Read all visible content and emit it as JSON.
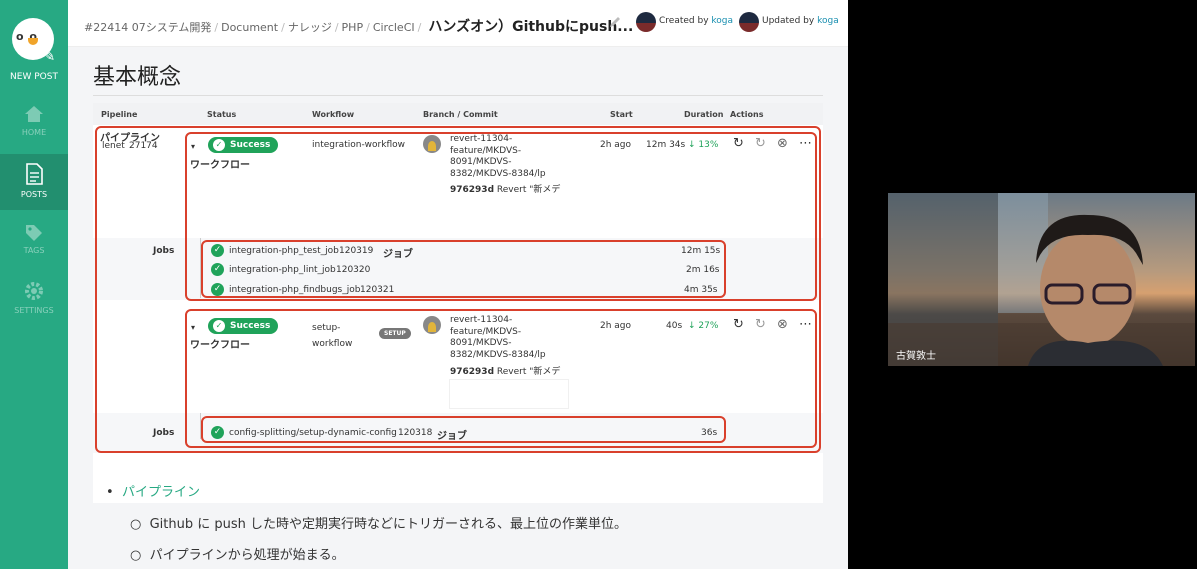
{
  "sidebar": {
    "newpost": "NEW POST",
    "items": [
      {
        "label": "HOME",
        "icon": "home-icon"
      },
      {
        "label": "POSTS",
        "icon": "document-icon"
      },
      {
        "label": "TAGS",
        "icon": "tag-icon"
      },
      {
        "label": "SETTINGS",
        "icon": "gear-icon"
      }
    ]
  },
  "topbar": {
    "crumbs": [
      "#22414",
      "07システム開発",
      "Document",
      "ナレッジ",
      "PHP",
      "CircleCI"
    ],
    "title": "ハンズオン）Githubにpush...",
    "created_label": "Created by",
    "created_user": "koga",
    "updated_label": "Updated by",
    "updated_user": "koga"
  },
  "content": {
    "heading": "基本概念",
    "table_headers": [
      "Pipeline",
      "Status",
      "Workflow",
      "Branch / Commit",
      "Start",
      "Duration",
      "Actions"
    ],
    "pipeline": {
      "name": "lenet",
      "number": "27174",
      "annotation": "パイプライン"
    },
    "workflows": [
      {
        "status": "Success",
        "annotation": "ワークフロー",
        "name": "integration-workflow",
        "branch": [
          "revert-11304-",
          "feature/MKDVS-",
          "8091/MKDVS-",
          "8382/MKDVS-8384/lp"
        ],
        "commit": "976293d",
        "commit_msg": "Revert \"新メデ",
        "start": "2h ago",
        "duration": "12m 34s",
        "change": "13%",
        "jobs_label": "Jobs",
        "jobs_annotation": "ジョブ",
        "jobs": [
          {
            "name": "integration-php_test_job",
            "id": "120319",
            "duration": "12m 15s"
          },
          {
            "name": "integration-php_lint_job",
            "id": "120320",
            "duration": "2m 16s"
          },
          {
            "name": "integration-php_findbugs_job",
            "id": "120321",
            "duration": "4m 35s"
          }
        ]
      },
      {
        "status": "Success",
        "annotation": "ワークフロー",
        "name": "setup-workflow",
        "name_lines": [
          "setup-",
          "workflow"
        ],
        "tag": "SETUP",
        "branch": [
          "revert-11304-",
          "feature/MKDVS-",
          "8091/MKDVS-",
          "8382/MKDVS-8384/lp"
        ],
        "commit": "976293d",
        "commit_msg": "Revert \"新メデ",
        "start": "2h ago",
        "duration": "40s",
        "change": "27%",
        "jobs_label": "Jobs",
        "jobs_annotation": "ジョブ",
        "jobs": [
          {
            "name": "config-splitting/setup-dynamic-config",
            "id": "120318",
            "duration": "36s"
          }
        ]
      }
    ],
    "bullet_main": "パイプライン",
    "bullet_sub1": "Github に push した時や定期実行時などにトリガーされる、最上位の作業単位。",
    "bullet_sub2": "パイプラインから処理が始まる。"
  },
  "video": {
    "name": "古賀敦士"
  },
  "colors": {
    "brand": "#27a983",
    "success": "#20a35a",
    "annotation": "#d9402c",
    "link": "#1d6fc4"
  }
}
